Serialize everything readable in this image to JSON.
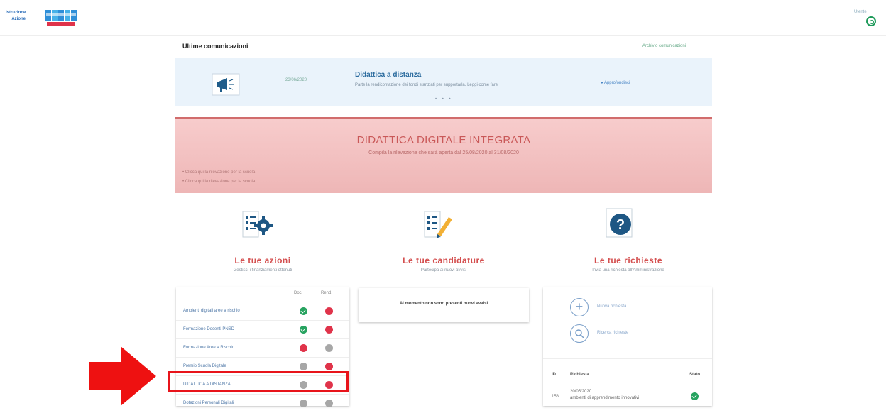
{
  "header": {
    "brand_line1": "Istruzione",
    "brand_line2": "Azione",
    "user_label": "Utente"
  },
  "communications": {
    "title": "Ultime comunicazioni",
    "archive_link": "Archivio comunicazioni",
    "item": {
      "date": "23/06/2020",
      "title": "Didattica a distanza",
      "text": "Parte la rendicontazione dei fondi stanziati per supportarla. Leggi come fare",
      "link": "Approfondisci"
    },
    "dots": "• • •"
  },
  "banner": {
    "title": "DIDATTICA DIGITALE INTEGRATA",
    "subtitle": "Compila la rilevazione che sarà aperta dal 25/08/2020 al 31/08/2020",
    "links": [
      "Clicca qui la rilevazione per la scuola",
      "Clicca qui la rilevazione per la scuola"
    ]
  },
  "actions": {
    "title": "Le tue azioni",
    "subtitle": "Gestisci i finanziamenti ottenuti",
    "col_doc": "Doc.",
    "col_rend": "Rend.",
    "rows": [
      {
        "label": "Ambienti digitali aree a rischio",
        "doc": "green",
        "rend": "red"
      },
      {
        "label": "Formazione Docenti PNSD",
        "doc": "green",
        "rend": "red"
      },
      {
        "label": "Formazione Aree a Rischio",
        "doc": "red",
        "rend": "gray"
      },
      {
        "label": "Premio Scuola Digitale",
        "doc": "gray",
        "rend": "red"
      },
      {
        "label": "DIDATTICA A DISTANZA",
        "doc": "gray",
        "rend": "red"
      },
      {
        "label": "Dotazioni Personali Digitali",
        "doc": "gray",
        "rend": "gray"
      }
    ]
  },
  "candidature": {
    "title": "Le tue candidature",
    "subtitle": "Partecipa ai nuovi avvisi",
    "empty_text": "Al momento non sono presenti nuovi avvisi"
  },
  "requests": {
    "title": "Le tue richieste",
    "subtitle": "Invia una richiesta all'Amministrazione",
    "new_label": "Nuova richiesta",
    "search_label": "Ricerca richieste",
    "col_id": "ID",
    "col_request": "Richiesta",
    "col_status": "Stato",
    "row": {
      "id": "158",
      "date": "20/05/2020",
      "text": "ambienti di apprendimento innovativi"
    }
  }
}
